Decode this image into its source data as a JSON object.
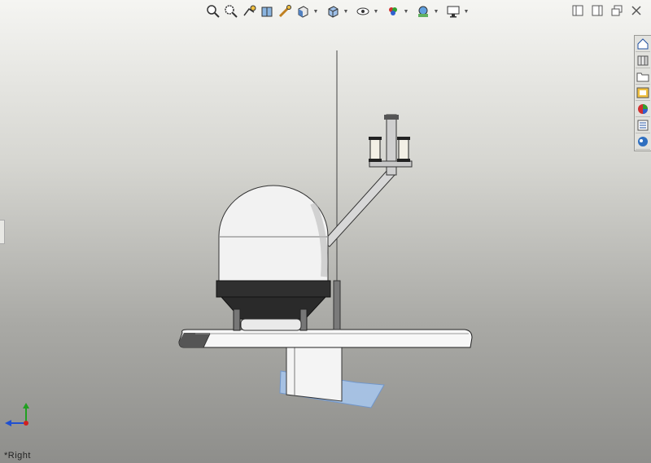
{
  "toolbar": {
    "items": [
      {
        "name": "zoom-to-fit-icon",
        "label": "Zoom to Fit"
      },
      {
        "name": "zoom-to-area-icon",
        "label": "Zoom to Area"
      },
      {
        "name": "previous-view-icon",
        "label": "Previous View"
      },
      {
        "name": "section-view-icon",
        "label": "Section View"
      },
      {
        "name": "dynamic-annotation-icon",
        "label": "Dynamic Annotation Views"
      },
      {
        "name": "view-orientation-icon",
        "label": "View Orientation"
      },
      {
        "name": "display-style-icon",
        "label": "Display Style"
      },
      {
        "name": "hide-show-items-icon",
        "label": "Hide/Show Items"
      },
      {
        "name": "edit-appearance-icon",
        "label": "Edit Appearance"
      },
      {
        "name": "apply-scene-icon",
        "label": "Apply Scene"
      },
      {
        "name": "view-settings-icon",
        "label": "View Settings"
      }
    ]
  },
  "viewport": {
    "view_name": "*Right",
    "colors": {
      "background_top": "#f5f5f2",
      "background_bottom": "#8e8e8b",
      "model_light": "#f4f4f4",
      "model_dark": "#2f2f2f",
      "axis_x": "#d02020",
      "axis_y": "#20a020",
      "axis_z": "#2050d0",
      "plane": "#9fc3ef"
    }
  },
  "taskpane": {
    "tabs": [
      {
        "name": "solidworks-resources-icon"
      },
      {
        "name": "design-library-icon"
      },
      {
        "name": "file-explorer-icon"
      },
      {
        "name": "view-palette-icon"
      },
      {
        "name": "appearances-icon"
      },
      {
        "name": "custom-properties-icon"
      },
      {
        "name": "solidworks-forum-icon"
      }
    ]
  }
}
